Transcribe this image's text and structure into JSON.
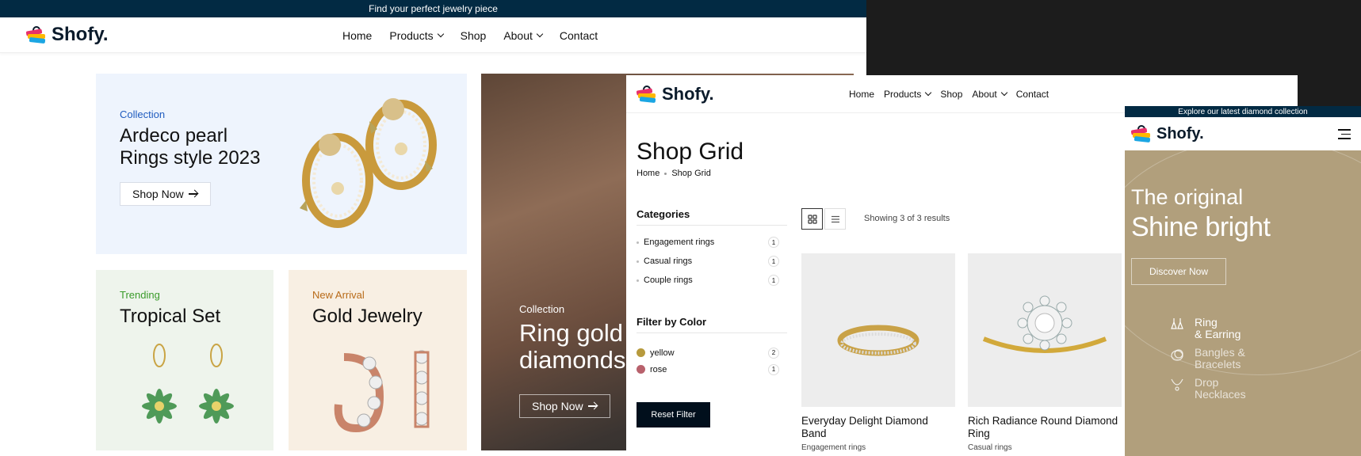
{
  "home": {
    "topbar": "Find your perfect jewelry piece",
    "logo": "Shofy.",
    "nav": [
      "Home",
      "Products",
      "Shop",
      "About",
      "Contact"
    ],
    "cards": [
      {
        "sub": "Collection",
        "title_l1": "Ardeco pearl",
        "title_l2": "Rings style 2023",
        "button": "Shop Now"
      },
      {
        "sub": "Trending",
        "title": "Tropical Set"
      },
      {
        "sub": "New Arrival",
        "title": "Gold Jewelry"
      },
      {
        "sub": "Collection",
        "title_l1": "Ring gold with",
        "title_l2": "diamonds",
        "button": "Shop Now"
      }
    ]
  },
  "shop": {
    "logo": "Shofy.",
    "nav": [
      "Home",
      "Products",
      "Shop",
      "About",
      "Contact"
    ],
    "page_title": "Shop Grid",
    "breadcrumb": [
      "Home",
      "Shop Grid"
    ],
    "categories_heading": "Categories",
    "categories": [
      {
        "label": "Engagement rings",
        "count": "1"
      },
      {
        "label": "Casual rings",
        "count": "1"
      },
      {
        "label": "Couple rings",
        "count": "1"
      }
    ],
    "color_heading": "Filter by Color",
    "colors": [
      {
        "label": "yellow",
        "count": "2",
        "hex": "#b79a3d"
      },
      {
        "label": "rose",
        "count": "1",
        "hex": "#b8616c"
      }
    ],
    "reset_label": "Reset Filter",
    "results": "Showing 3 of 3 results",
    "products": [
      {
        "name": "Everyday Delight Diamond Band",
        "category": "Engagement rings"
      },
      {
        "name": "Rich Radiance Round Diamond Ring",
        "category": "Casual rings"
      }
    ]
  },
  "mobile": {
    "topbar": "Explore our latest diamond collection",
    "logo": "Shofy.",
    "hero_sub": "The original",
    "hero_title": "Shine bright",
    "discover": "Discover Now",
    "categories": [
      {
        "l1": "Ring",
        "l2": "& Earring"
      },
      {
        "l1": "Bangles &",
        "l2": "Bracelets"
      },
      {
        "l1": "Drop",
        "l2": "Necklaces"
      }
    ]
  }
}
